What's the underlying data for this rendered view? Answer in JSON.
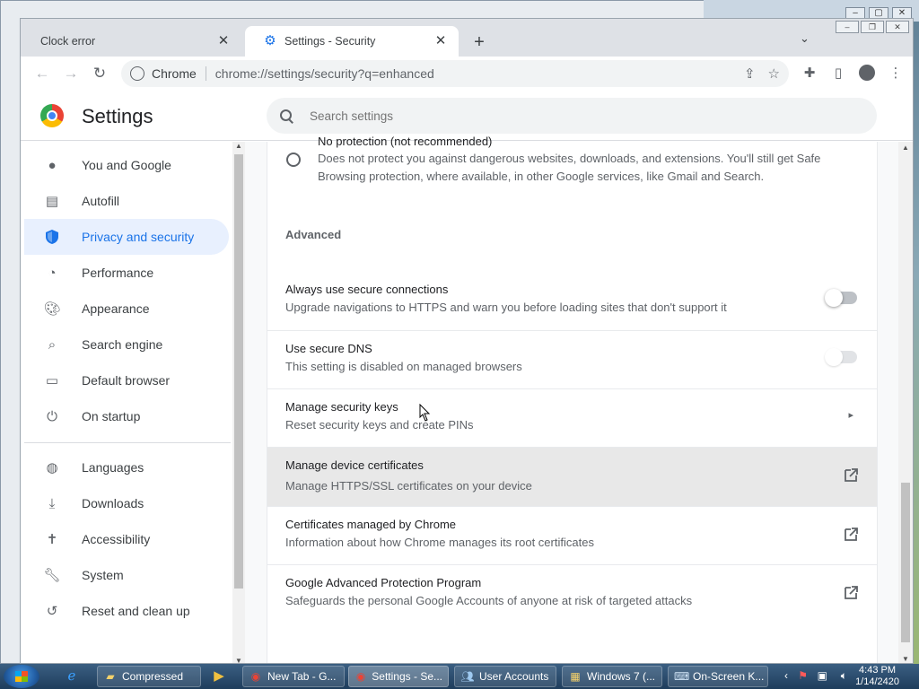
{
  "browser": {
    "tabs": [
      {
        "label": "Clock error",
        "active": false
      },
      {
        "label": "Settings - Security",
        "active": true
      }
    ],
    "address": {
      "site_label": "Chrome",
      "url": "chrome://settings/security?q=enhanced"
    }
  },
  "settings": {
    "title": "Settings",
    "search_placeholder": "Search settings"
  },
  "sidebar": {
    "items": [
      {
        "label": "You and Google",
        "icon": "person-icon"
      },
      {
        "label": "Autofill",
        "icon": "clipboard-icon"
      },
      {
        "label": "Privacy and security",
        "icon": "shield-icon",
        "selected": true
      },
      {
        "label": "Performance",
        "icon": "speedometer-icon"
      },
      {
        "label": "Appearance",
        "icon": "palette-icon"
      },
      {
        "label": "Search engine",
        "icon": "search-icon"
      },
      {
        "label": "Default browser",
        "icon": "browser-icon"
      },
      {
        "label": "On startup",
        "icon": "power-icon"
      },
      {
        "label": "Languages",
        "icon": "globe-icon"
      },
      {
        "label": "Downloads",
        "icon": "download-icon"
      },
      {
        "label": "Accessibility",
        "icon": "accessibility-icon"
      },
      {
        "label": "System",
        "icon": "wrench-icon"
      },
      {
        "label": "Reset and clean up",
        "icon": "history-icon"
      }
    ]
  },
  "main": {
    "no_protection": {
      "title": "No protection (not recommended)",
      "desc": "Does not protect you against dangerous websites, downloads, and extensions. You'll still get Safe Browsing protection, where available, in other Google services, like Gmail and Search."
    },
    "advanced_heading": "Advanced",
    "rows": [
      {
        "title": "Always use secure connections",
        "desc": "Upgrade navigations to HTTPS and warn you before loading sites that don't support it",
        "control": "toggle-off"
      },
      {
        "title": "Use secure DNS",
        "desc": "This setting is disabled on managed browsers",
        "control": "toggle-disabled"
      },
      {
        "title": "Manage security keys",
        "desc": "Reset security keys and create PINs",
        "control": "chevron"
      },
      {
        "title": "Manage device certificates",
        "desc": "Manage HTTPS/SSL certificates on your device",
        "control": "external-link"
      },
      {
        "title": "Certificates managed by Chrome",
        "desc": "Information about how Chrome manages its root certificates",
        "control": "external-link"
      },
      {
        "title": "Google Advanced Protection Program",
        "desc": "Safeguards the personal Google Accounts of anyone at risk of targeted attacks",
        "control": "external-link"
      }
    ]
  },
  "taskbar": {
    "buttons": [
      {
        "label": "Compressed"
      },
      {
        "label": "New Tab - G..."
      },
      {
        "label": "Settings - Se..."
      },
      {
        "label": "User Accounts"
      },
      {
        "label": "Windows 7 (..."
      },
      {
        "label": "On-Screen K..."
      }
    ],
    "time": "4:43 PM",
    "date": "1/14/2420"
  },
  "colors": {
    "accent": "#1a73e8",
    "selected_bg": "#e8f0fe",
    "highlight_row": "#e8e8e8"
  }
}
